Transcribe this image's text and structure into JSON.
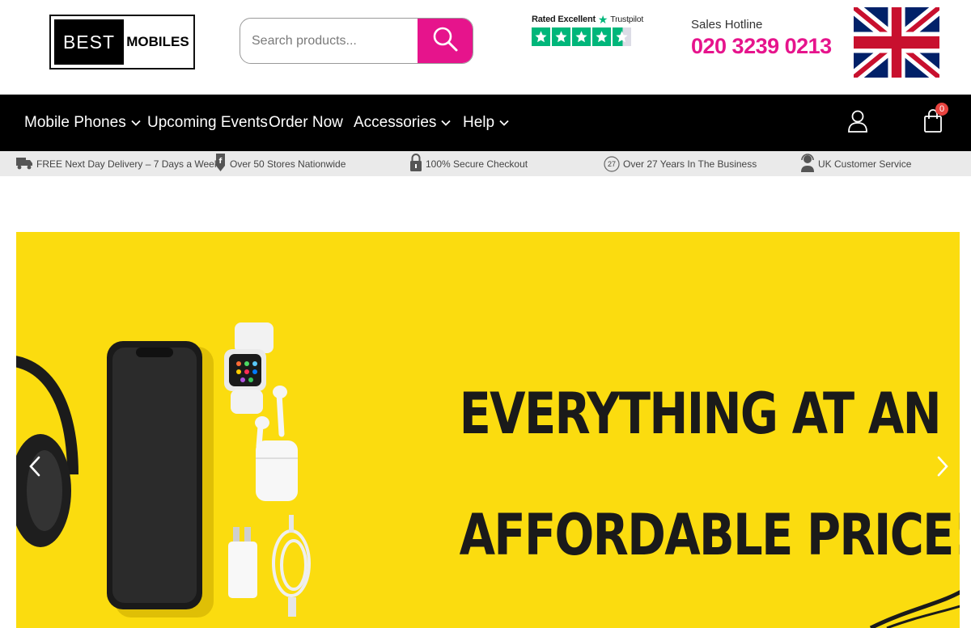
{
  "header": {
    "logo": {
      "left_text": "BEST",
      "right_text": "MOBILES"
    },
    "search": {
      "placeholder": "Search products...",
      "button_icon": "search-icon"
    },
    "trustpilot": {
      "rated_text": "Rated Excellent",
      "brand": "Trustpilot",
      "stars": 4.5
    },
    "hotline": {
      "label": "Sales Hotline",
      "number": "020 3239 0213"
    },
    "flag": "uk-flag-icon"
  },
  "nav": {
    "items": [
      {
        "label": "Mobile Phones",
        "dropdown": true
      },
      {
        "label": "Upcoming Events",
        "dropdown": false
      },
      {
        "label": "Order Now",
        "dropdown": false
      },
      {
        "label": "Accessories",
        "dropdown": true
      },
      {
        "label": "Help",
        "dropdown": true
      }
    ],
    "account_icon": "user-icon",
    "cart_icon": "shopping-bag-icon",
    "cart_count": "0"
  },
  "usp": [
    {
      "icon": "truck-icon",
      "text": "FREE Next Day Delivery – 7 Days a Week"
    },
    {
      "icon": "store-icon",
      "text": "Over 50 Stores Nationwide"
    },
    {
      "icon": "lock-icon",
      "text": "100% Secure Checkout"
    },
    {
      "icon": "27-years-badge-icon",
      "badge": "27",
      "text": "Over 27 Years In The Business"
    },
    {
      "icon": "headset-icon",
      "text": "UK Customer Service"
    }
  ],
  "hero": {
    "line1": "EVERYTHING AT AN",
    "line2": "AFFORDABLE PRICE!",
    "prev_icon": "chevron-left-icon",
    "next_icon": "chevron-right-icon"
  },
  "colors": {
    "brand_pink": "#e6148c",
    "nav_bg": "#000000",
    "usp_bg": "#eaeaea",
    "hero_bg": "#fbdc0f",
    "trustpilot_green": "#00b67a"
  }
}
